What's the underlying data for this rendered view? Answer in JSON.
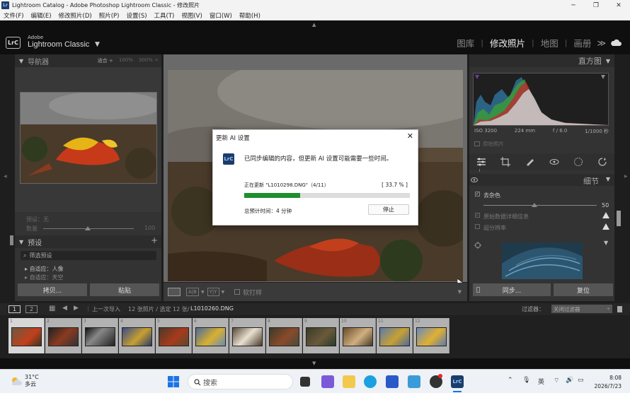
{
  "window": {
    "title": "Lightroom Catalog - Adobe Photoshop Lightroom Classic - 修改照片",
    "app_badge": "Lr"
  },
  "menu": [
    "文件(F)",
    "编辑(E)",
    "修改照片(D)",
    "照片(P)",
    "设置(S)",
    "工具(T)",
    "视图(V)",
    "窗口(W)",
    "帮助(H)"
  ],
  "brand": {
    "logo": "LrC",
    "small": "Adobe",
    "large": "Lightroom Classic"
  },
  "modules": [
    "图库",
    "修改照片",
    "地图",
    "画册"
  ],
  "active_module": "修改照片",
  "navigator": {
    "title": "导航器",
    "options": [
      "适合 ÷",
      "100%",
      "300% ÷"
    ]
  },
  "left_fields": {
    "preset_label": "预设：无",
    "amount_label": "数量",
    "amount_value": "100"
  },
  "presets": {
    "title": "预设",
    "add": "+",
    "filter_placeholder": "筛选预设",
    "items": [
      "自适应：人像",
      "自适应：天空"
    ]
  },
  "left_buttons": {
    "copy": "拷贝...",
    "paste": "粘贴"
  },
  "toolbar": {
    "view_ab": "A|B",
    "view_yy": "Y|Y",
    "softproof": "软打样"
  },
  "dialog": {
    "title": "更新 AI 设置",
    "close": "✕",
    "icon": "LrC",
    "message": "已同步编辑的内容，但更新 AI 设置可能需要一些时间。",
    "progress_label": "正在更新 \"L1010298.DNG\"（4/11）",
    "percent_text": "[ 33.7 % ]",
    "progress": 0.337,
    "eta": "总预计时间：4 分钟",
    "stop_button": "停止"
  },
  "histogram": {
    "title": "直方图",
    "info": [
      "ISO 3200",
      "224 mm",
      "f / 6.0",
      "1/1000 秒"
    ],
    "original_photo": "原始照片"
  },
  "detail": {
    "title": "细节",
    "denoise_label": "去杂色",
    "denoise_value": "50",
    "raw_details": "原始数据详细信息",
    "super_resolution": "超分辨率"
  },
  "right_buttons": {
    "sync": "同步...",
    "reset": "复位"
  },
  "filmstrip": {
    "screen1": "1",
    "screen2": "2",
    "source": "上一次导入",
    "count": "12 张照片 / 选定 12 张/",
    "filename": "L1010260.DNG",
    "filter_label": "过滤器：",
    "filter_value": "关闭过滤器",
    "thumbs": [
      "1",
      "2",
      "3",
      "4",
      "5",
      "6",
      "7",
      "8",
      "9",
      "10",
      "11",
      "12"
    ]
  },
  "taskbar": {
    "temp": "31°C",
    "weather": "多云",
    "search": "搜索",
    "ime": "英",
    "time": "8:08",
    "date": "2026/7/23"
  },
  "colors": {
    "progress_fill": "#1e8f2c",
    "lrc_badge": "#1b3d6b"
  }
}
